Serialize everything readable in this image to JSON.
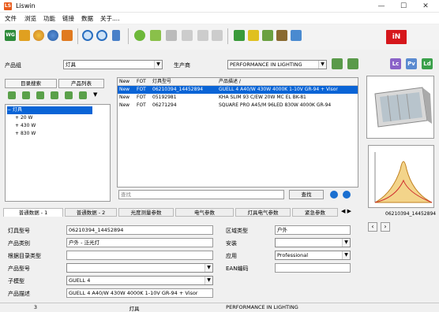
{
  "window": {
    "title": "Liswin",
    "app_icon": "LS"
  },
  "menu": [
    "文件",
    "浏览",
    "功能",
    "链接",
    "数据",
    "关于...."
  ],
  "toolbar": {
    "logo": "iN"
  },
  "filters": {
    "group_label": "产品组",
    "group_value": "灯具",
    "maker_label": "生产商",
    "maker_value": "PERFORMANCE IN LIGHTING",
    "right_icons": [
      "Lc",
      "Pv",
      "Ld"
    ]
  },
  "left_tabs": [
    "目录搜索",
    "产品列表"
  ],
  "tree": [
    {
      "label": "灯具",
      "expander": "−",
      "selected": true
    },
    {
      "label": "20 W",
      "expander": "+",
      "selected": false
    },
    {
      "label": "430 W",
      "expander": "+",
      "selected": false
    },
    {
      "label": "830 W",
      "expander": "+",
      "selected": false
    }
  ],
  "table": {
    "headers": [
      "New",
      "FOT",
      "灯具型号",
      "产品描述 /"
    ],
    "rows": [
      [
        "New",
        "FOT",
        "06210394_14452894",
        "GUELL 4 A40/W 430W 4000K 1-10V GR-94 + Visor"
      ],
      [
        "New",
        "FOT",
        "05192981",
        "KHA SLIM 93 C/EW 20W MC EL BK-81"
      ],
      [
        "New",
        "FOT",
        "06271294",
        "SQUARE PRO A45/M 96LED 830W 4000K GR-94"
      ]
    ],
    "search_placeholder": "查找",
    "search_button": "查找"
  },
  "data_tabs": [
    "普通数据 - 1",
    "普通数据 - 2",
    "光度测量参数",
    "电气参数",
    "灯具电气参数",
    "紧急参数"
  ],
  "details_left": [
    {
      "label": "灯具型号",
      "value": ""
    },
    {
      "label": "产品类别",
      "value": "户外 - 泛光灯"
    },
    {
      "label": "根据目录类型",
      "value": ""
    },
    {
      "label": "产品型号",
      "value": ""
    },
    {
      "label": "子模型",
      "value": "GUELL 4"
    },
    {
      "label": "产品描述",
      "value": "GUELL 4 A40/W 430W 4000K 1-10V GR-94 + Visor"
    }
  ],
  "lamp_model_value": "06210394_14452894",
  "details_right": [
    {
      "label": "区域类型",
      "value": "户外"
    },
    {
      "label": "安装",
      "value": ""
    },
    {
      "label": "应用",
      "value": "Professional"
    },
    {
      "label": "EAN编码",
      "value": ""
    }
  ],
  "preview_caption": "06210394_14452894",
  "status": [
    "3",
    "灯具",
    "PERFORMANCE IN LIGHTING"
  ],
  "colors": {
    "selection": "#0a64d6",
    "logo": "#d6171c",
    "accent": "#e85a1b"
  }
}
